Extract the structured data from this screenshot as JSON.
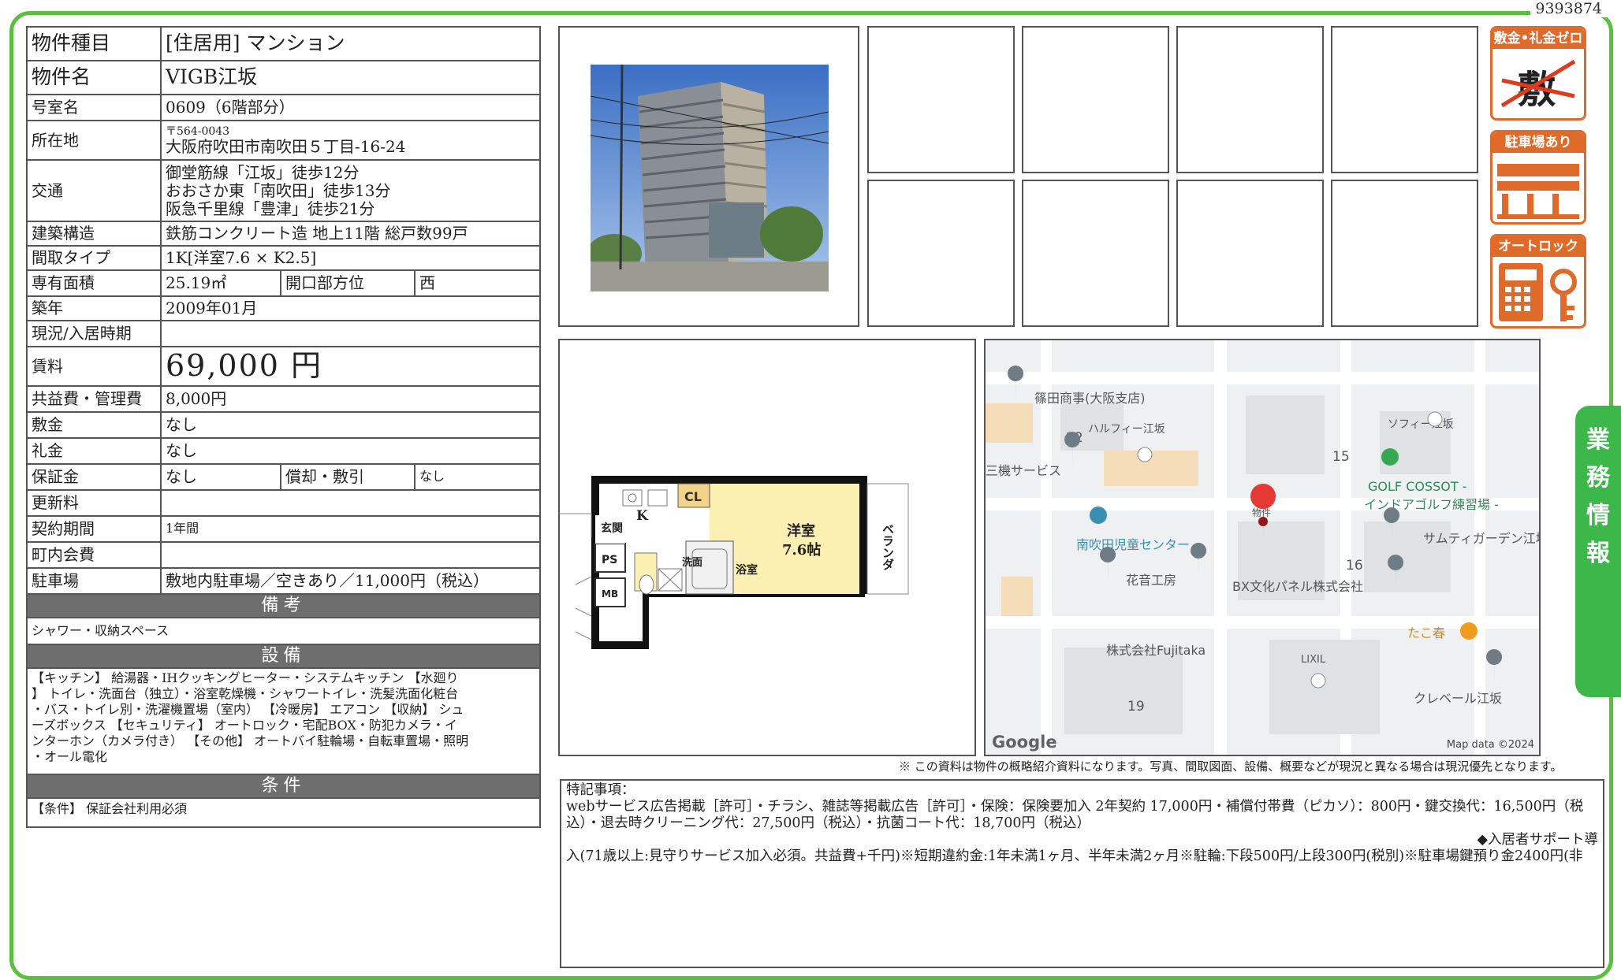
{
  "doc_number": "9393874",
  "property": {
    "type_label": "物件種目",
    "type_value": "[住居用] マンション",
    "name_label": "物件名",
    "name_value": "VIGB江坂",
    "room_label": "号室名",
    "room_value": "0609（6階部分）",
    "address_label": "所在地",
    "postal": "〒564-0043",
    "address": "大阪府吹田市南吹田５丁目-16-24",
    "access_label": "交通",
    "access": [
      "御堂筋線「江坂」徒歩12分",
      "おおさか東「南吹田」徒歩13分",
      "阪急千里線「豊津」徒歩21分"
    ],
    "structure_label": "建築構造",
    "structure_value": "鉄筋コンクリート造 地上11階 総戸数99戸",
    "layout_label": "間取タイプ",
    "layout_value": "1K[洋室7.6 × K2.5]",
    "area_label": "専有面積",
    "area_value": "25.19㎡",
    "facing_label": "開口部方位",
    "facing_value": "西",
    "built_label": "築年",
    "built_value": "2009年01月",
    "status_label": "現況/入居時期",
    "status_value": "",
    "rent_label": "賃料",
    "rent_value": "69,000 円",
    "fee_label": "共益費・管理費",
    "fee_value": "8,000円",
    "deposit_label": "敷金",
    "deposit_value": "なし",
    "keymoney_label": "礼金",
    "keymoney_value": "なし",
    "guarantee_label": "保証金",
    "guarantee_value": "なし",
    "amort_label": "償却・敷引",
    "amort_value": "なし",
    "renewal_label": "更新料",
    "renewal_value": "",
    "contract_label": "契約期間",
    "contract_value": "1年間",
    "community_label": "町内会費",
    "community_value": "",
    "parking_label": "駐車場",
    "parking_value": "敷地内駐車場／空きあり／11,000円（税込）"
  },
  "sections": {
    "remarks_title": "備考",
    "remarks_text": "シャワー・収納スペース",
    "equipment_title": "設備",
    "equipment_lines": [
      "【キッチン】 給湯器・IHクッキングヒーター・システムキッチン 【水廻り",
      "】 トイレ・洗面台（独立）・浴室乾燥機・シャワートイレ・洗髪洗面化粧台",
      "・バス・トイレ別・洗濯機置場（室内） 【冷暖房】 エアコン 【収納】 シュ",
      "ーズボックス 【セキュリティ】 オートロック・宅配BOX・防犯カメラ・イ",
      "ンターホン（カメラ付き） 【その他】 オートバイ駐輪場・自転車置場・照明",
      "・オール電化"
    ],
    "conditions_title": "条件",
    "conditions_text": "【条件】 保証会社利用必須"
  },
  "icons": {
    "zero": {
      "title": "敷金•礼金ゼロ",
      "text": "敷 礼"
    },
    "parking": {
      "title": "駐車場あり"
    },
    "autolock": {
      "title": "オートロック"
    }
  },
  "side_tab": [
    "業",
    "務",
    "情",
    "報"
  ],
  "floorplan": {
    "cl": "CL",
    "genkan": "玄関",
    "k": "K",
    "ps": "PS",
    "mb": "MB",
    "senmen": "洗面",
    "yokushitsu": "浴室",
    "room": "洋室",
    "room_size": "7.6帖",
    "veranda": "ベランダ"
  },
  "map": {
    "labels": [
      "篠田商事(大阪支店)",
      "ハルフィー江坂",
      "ソフィー江坂",
      "三機サービス",
      "GOLF COSSOT -",
      "インドアゴルフ練習場 -",
      "南吹田児童センター",
      "サムティガーデン江坂",
      "花音工房",
      "BX文化パネル株式会社",
      "たこ春",
      "株式会社Fujitaka",
      "LIXIL",
      "クレベール江坂",
      "物件"
    ],
    "numbers": [
      "22",
      "15",
      "16",
      "19"
    ],
    "google": "Google",
    "attribution": "Map data ©2024"
  },
  "note": "※ この資料は物件の概略紹介資料になります。写真、間取図面、設備、概要などが現況と異なる場合は現況優先となります。",
  "special": {
    "heading": "特記事項：",
    "line1": "webサービス広告掲載［許可］・チラシ、雑誌等掲載広告［許可］・保険：保険要加入 2年契約 17,000円・補償付帯費（ピカソ）：800円・鍵交換代：16,500円（税",
    "line2": "込）・退去時クリーニング代：27,500円（税込）・抗菌コート代：18,700円（税込）",
    "line3": "◆入居者サポート導",
    "line4": "入(71歳以上:見守りサービス加入必須。共益費+千円)※短期違約金:1年未満1ヶ月、半年未満2ヶ月※駐輪:下段500円/上段300円(税別)※駐車場鍵預り金2400円(非"
  }
}
